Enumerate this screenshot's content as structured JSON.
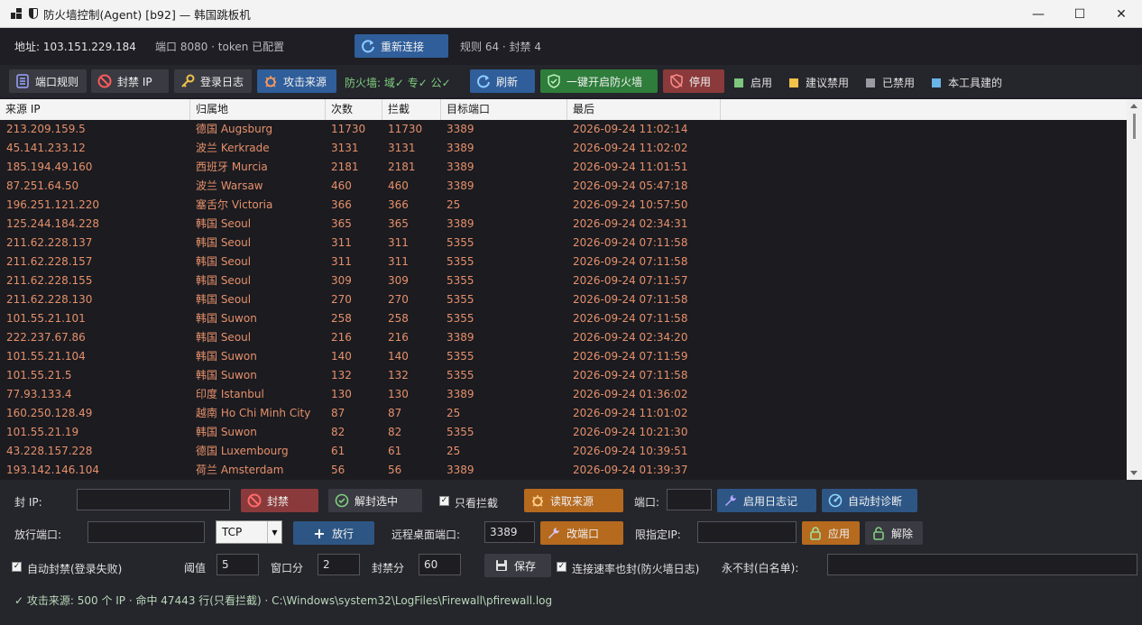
{
  "window": {
    "title": "防火墙控制(Agent) [b92] — 韩国跳板机",
    "minimize": "—",
    "maximize": "☐",
    "close": "✕"
  },
  "info": {
    "address": "地址: 103.151.229.184",
    "port_token": "端口 8080 · token 已配置",
    "reconnect": "重新连接",
    "rules_summary": "规则 64 · 封禁 4"
  },
  "toolbar": {
    "port_rules": "端口规则",
    "ban_ip": "封禁 IP",
    "login_log": "登录日志",
    "attack_sources": "攻击来源",
    "firewall_status": "防火墙: 域✓  专✓  公✓",
    "refresh": "刷新",
    "enable_firewall": "一键开启防火墙",
    "disable": "停用"
  },
  "legend": [
    {
      "label": "启用",
      "color": "#7ec67e"
    },
    {
      "label": "建议禁用",
      "color": "#f0c24a"
    },
    {
      "label": "已禁用",
      "color": "#9a9aa2"
    },
    {
      "label": "本工具建的",
      "color": "#6ab4e8"
    }
  ],
  "table": {
    "columns": [
      "来源 IP",
      "归属地",
      "次数",
      "拦截",
      "目标端口",
      "最后"
    ],
    "rows": [
      [
        "213.209.159.5",
        "德国 Augsburg",
        "11730",
        "11730",
        "3389",
        "2026-09-24 11:02:14"
      ],
      [
        "45.141.233.12",
        "波兰 Kerkrade",
        "3131",
        "3131",
        "3389",
        "2026-09-24 11:02:02"
      ],
      [
        "185.194.49.160",
        "西班牙 Murcia",
        "2181",
        "2181",
        "3389",
        "2026-09-24 11:01:51"
      ],
      [
        "87.251.64.50",
        "波兰 Warsaw",
        "460",
        "460",
        "3389",
        "2026-09-24 05:47:18"
      ],
      [
        "196.251.121.220",
        "塞舌尔 Victoria",
        "366",
        "366",
        "25",
        "2026-09-24 10:57:50"
      ],
      [
        "125.244.184.228",
        "韩国 Seoul",
        "365",
        "365",
        "3389",
        "2026-09-24 02:34:31"
      ],
      [
        "211.62.228.137",
        "韩国 Seoul",
        "311",
        "311",
        "5355",
        "2026-09-24 07:11:58"
      ],
      [
        "211.62.228.157",
        "韩国 Seoul",
        "311",
        "311",
        "5355",
        "2026-09-24 07:11:58"
      ],
      [
        "211.62.228.155",
        "韩国 Seoul",
        "309",
        "309",
        "5355",
        "2026-09-24 07:11:57"
      ],
      [
        "211.62.228.130",
        "韩国 Seoul",
        "270",
        "270",
        "5355",
        "2026-09-24 07:11:58"
      ],
      [
        "101.55.21.101",
        "韩国 Suwon",
        "258",
        "258",
        "5355",
        "2026-09-24 07:11:58"
      ],
      [
        "222.237.67.86",
        "韩国 Seoul",
        "216",
        "216",
        "3389",
        "2026-09-24 02:34:20"
      ],
      [
        "101.55.21.104",
        "韩国 Suwon",
        "140",
        "140",
        "5355",
        "2026-09-24 07:11:59"
      ],
      [
        "101.55.21.5",
        "韩国 Suwon",
        "132",
        "132",
        "5355",
        "2026-09-24 07:11:58"
      ],
      [
        "77.93.133.4",
        "印度 Istanbul",
        "130",
        "130",
        "3389",
        "2026-09-24 01:36:02"
      ],
      [
        "160.250.128.49",
        "越南 Ho Chi Minh City",
        "87",
        "87",
        "25",
        "2026-09-24 11:01:02"
      ],
      [
        "101.55.21.19",
        "韩国 Suwon",
        "82",
        "82",
        "5355",
        "2026-09-24 10:21:30"
      ],
      [
        "43.228.157.228",
        "德国 Luxembourg",
        "61",
        "61",
        "25",
        "2026-09-24 10:39:51"
      ],
      [
        "193.142.146.104",
        "荷兰 Amsterdam",
        "56",
        "56",
        "3389",
        "2026-09-24 01:39:37"
      ]
    ]
  },
  "panel": {
    "ban_ip_label": "封 IP:",
    "ban_ip_value": "",
    "ban_btn": "封禁",
    "unban_btn": "解封选中",
    "only_blocked": "只看拦截",
    "read_sources": "读取来源",
    "port_label": "端口:",
    "port_value": "",
    "enable_logging": "启用日志记",
    "auto_ban_diag": "自动封诊断",
    "allow_port_label": "放行端口:",
    "allow_port_value": "",
    "protocol": "TCP",
    "allow_btn": "放行",
    "rdp_port_label": "远程桌面端口:",
    "rdp_port_value": "3389",
    "change_port": "改端口",
    "restrict_ip_label": "限指定IP:",
    "restrict_ip_value": "",
    "apply": "应用",
    "release": "解除",
    "auto_ban_label": "自动封禁(登录失败)",
    "threshold_label": "阈值",
    "threshold_value": "5",
    "window_label": "窗口分",
    "window_value": "2",
    "ban_minutes_label": "封禁分",
    "ban_minutes_value": "60",
    "save": "保存",
    "rate_ban_label": "连接速率也封(防火墙日志)",
    "whitelist_label": "永不封(白名单):",
    "whitelist_value": ""
  },
  "status": "✓ 攻击来源: 500 个 IP · 命中 47443 行(只看拦截) · C:\\Windows\\system32\\LogFiles\\Firewall\\pfirewall.log"
}
